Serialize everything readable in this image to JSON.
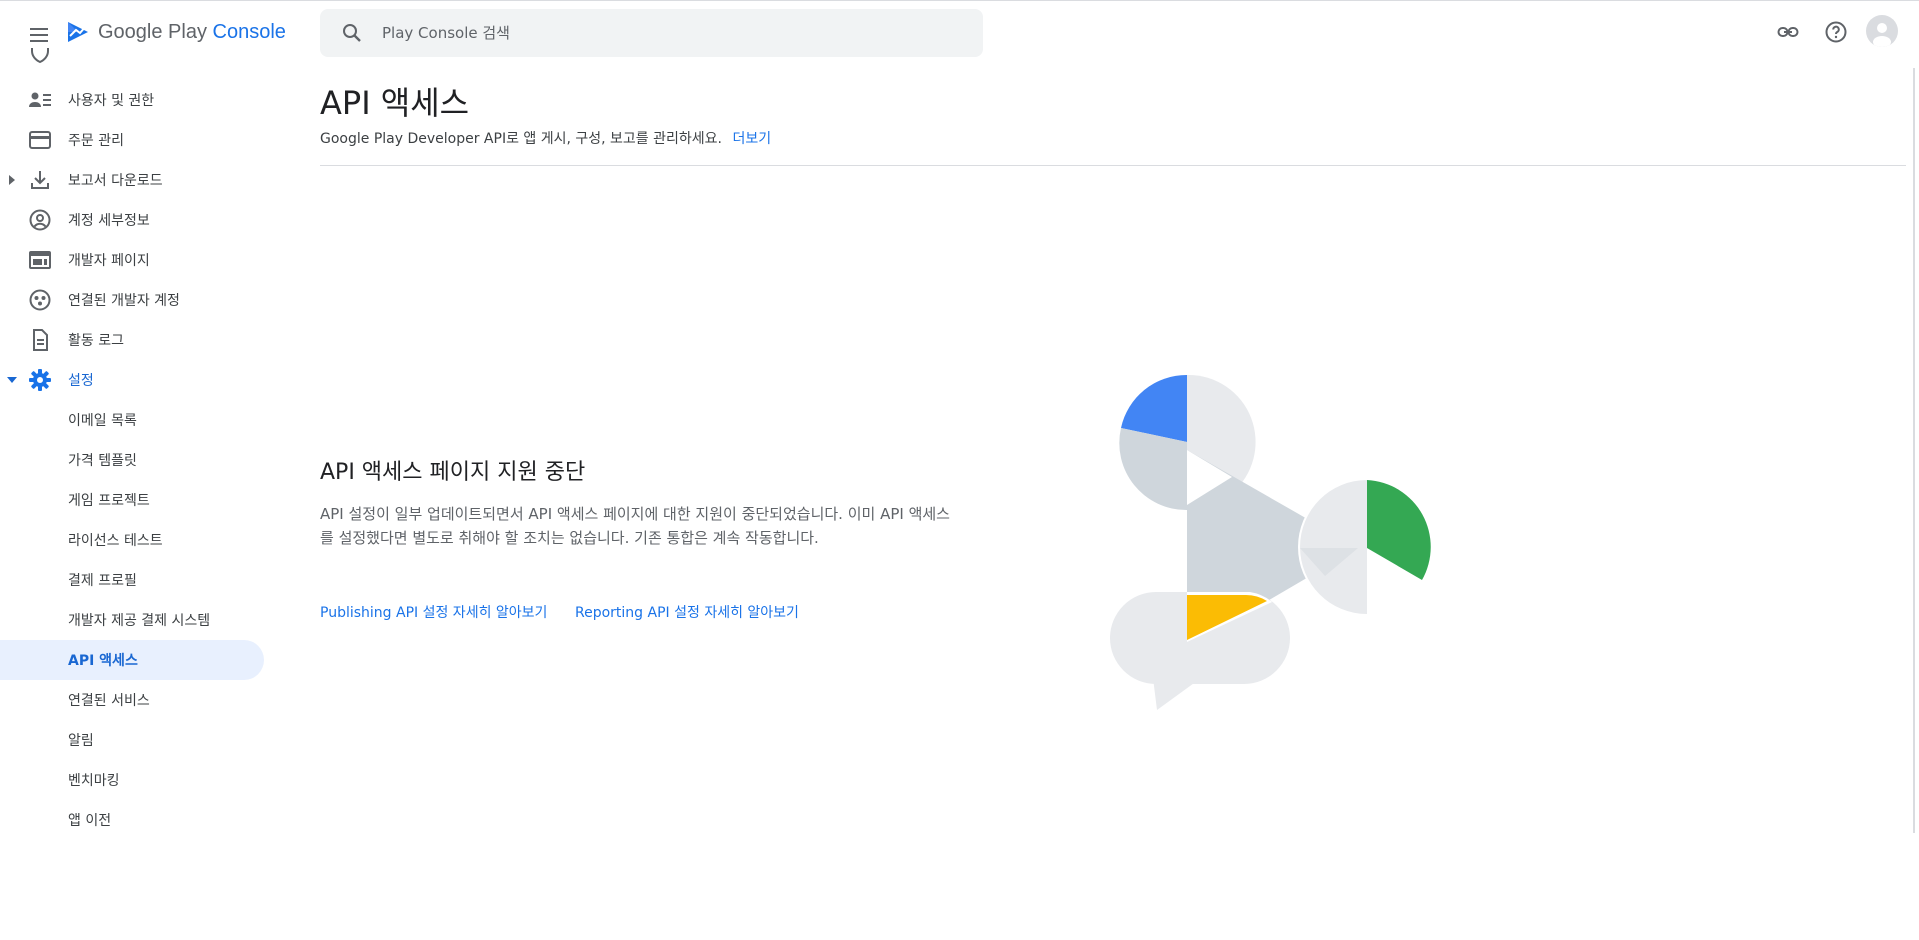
{
  "app": {
    "logo_text_main": "Google Play",
    "logo_text_accent": "Console"
  },
  "header": {
    "search_placeholder": "Play Console 검색"
  },
  "sidebar": {
    "items": [
      {
        "label": "사용자 및 권한",
        "icon": "person-list-icon"
      },
      {
        "label": "주문 관리",
        "icon": "credit-card-icon"
      },
      {
        "label": "보고서 다운로드",
        "icon": "download-icon"
      },
      {
        "label": "계정 세부정보",
        "icon": "account-circle-icon"
      },
      {
        "label": "개발자 페이지",
        "icon": "web-page-icon"
      },
      {
        "label": "연결된 개발자 계정",
        "icon": "linked-accounts-icon"
      },
      {
        "label": "활동 로그",
        "icon": "document-icon"
      },
      {
        "label": "설정",
        "icon": "gear-icon"
      }
    ],
    "settings_sub": [
      "이메일 목록",
      "가격 템플릿",
      "게임 프로젝트",
      "라이선스 테스트",
      "결제 프로필",
      "개발자 제공 결제 시스템",
      "API 액세스",
      "연결된 서비스",
      "알림",
      "벤치마킹",
      "앱 이전"
    ]
  },
  "main": {
    "title": "API 액세스",
    "subtitle": "Google Play Developer API로 앱 게시, 구성, 보고를 관리하세요.",
    "subtitle_link": "더보기",
    "section_title": "API 액세스 페이지 지원 중단",
    "section_body": "API 설정이 일부 업데이트되면서 API 액세스 페이지에 대한 지원이 중단되었습니다. 이미 API 액세스를 설정했다면 별도로 취해야 할 조치는 없습니다. 기존 통합은 계속 작동합니다.",
    "link_publishing": "Publishing API 설정 자세히 알아보기",
    "link_reporting": "Reporting API 설정 자세히 알아보기"
  },
  "colors": {
    "accent": "#1a73e8",
    "active_bg": "#e8f0fe",
    "illustration_blue": "#4285f4",
    "illustration_green": "#34a853",
    "illustration_yellow": "#fbbc04",
    "illustration_grey": "#cfd6dc",
    "illustration_light": "#e8eaed"
  }
}
